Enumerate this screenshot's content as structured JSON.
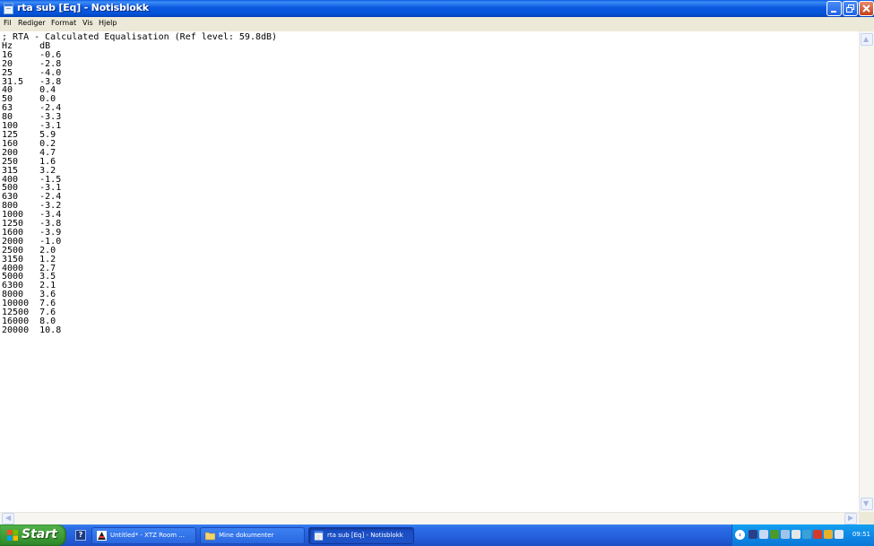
{
  "window": {
    "title": "rta sub [Eq] - Notisblokk",
    "buttons": {
      "minimize": "minimize",
      "maximize": "maximize",
      "close": "close"
    }
  },
  "menu": [
    "Fil",
    "Rediger",
    "Format",
    "Vis",
    "Hjelp"
  ],
  "document": {
    "header": "; RTA - Calculated Equalisation (Ref level: 59.8dB)",
    "columns": [
      "Hz",
      "dB"
    ],
    "rows": [
      [
        "16",
        "-0.6"
      ],
      [
        "20",
        "-2.8"
      ],
      [
        "25",
        "-4.0"
      ],
      [
        "31.5",
        "-3.8"
      ],
      [
        "40",
        "0.4"
      ],
      [
        "50",
        "0.0"
      ],
      [
        "63",
        "-2.4"
      ],
      [
        "80",
        "-3.3"
      ],
      [
        "100",
        "-3.1"
      ],
      [
        "125",
        "5.9"
      ],
      [
        "160",
        "0.2"
      ],
      [
        "200",
        "4.7"
      ],
      [
        "250",
        "1.6"
      ],
      [
        "315",
        "3.2"
      ],
      [
        "400",
        "-1.5"
      ],
      [
        "500",
        "-3.1"
      ],
      [
        "630",
        "-2.4"
      ],
      [
        "800",
        "-3.2"
      ],
      [
        "1000",
        "-3.4"
      ],
      [
        "1250",
        "-3.8"
      ],
      [
        "1600",
        "-3.9"
      ],
      [
        "2000",
        "-1.0"
      ],
      [
        "2500",
        "2.0"
      ],
      [
        "3150",
        "1.2"
      ],
      [
        "4000",
        "2.7"
      ],
      [
        "5000",
        "3.5"
      ],
      [
        "6300",
        "2.1"
      ],
      [
        "8000",
        "3.6"
      ],
      [
        "10000",
        "7.6"
      ],
      [
        "12500",
        "7.6"
      ],
      [
        "16000",
        "8.0"
      ],
      [
        "20000",
        "10.8"
      ]
    ]
  },
  "taskbar": {
    "start_label": "Start",
    "quicklaunch_help": "?",
    "tasks": [
      {
        "label": "Untitled* - XTZ Room ...",
        "icon": "xtz-room-icon",
        "active": false
      },
      {
        "label": "Mine dokumenter",
        "icon": "folder-icon",
        "active": false
      },
      {
        "label": "rta sub [Eq] - Notisblokk",
        "icon": "notepad-icon",
        "active": true
      }
    ],
    "clock": "09:51"
  },
  "colors": {
    "titlebar": "#0a58e0",
    "start": "#3c9a35",
    "taskbar": "#245edb",
    "tray": "#0f89e6",
    "close_button": "#c5411b"
  }
}
